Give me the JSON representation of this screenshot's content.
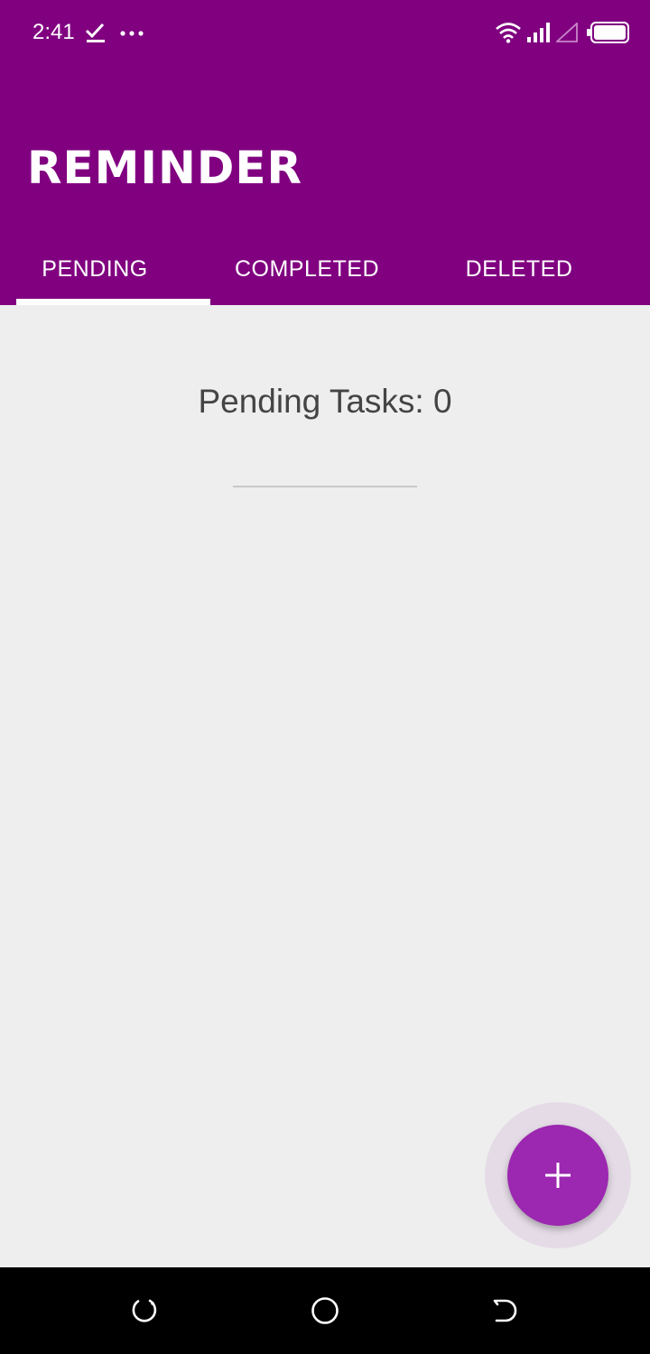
{
  "status_bar": {
    "time": "2:41",
    "icons": [
      "check-notification-icon",
      "more-notifications-icon",
      "wifi-icon",
      "cellular-signal-icon",
      "cellular-signal-empty-icon",
      "battery-icon"
    ]
  },
  "app": {
    "title": "REMINDER"
  },
  "tabs": [
    {
      "label": "PENDING",
      "selected": true
    },
    {
      "label": "COMPLETED",
      "selected": false
    },
    {
      "label": "DELETED",
      "selected": false
    }
  ],
  "content": {
    "pending_count_text": "Pending Tasks: 0"
  },
  "fab": {
    "icon": "plus-icon"
  },
  "navigation": {
    "buttons": [
      "recent-apps-icon",
      "home-icon",
      "back-icon"
    ]
  },
  "colors": {
    "app_bar": "#800080",
    "fab": "#9c27b0",
    "background": "#eeeeee",
    "text": "#444444"
  }
}
